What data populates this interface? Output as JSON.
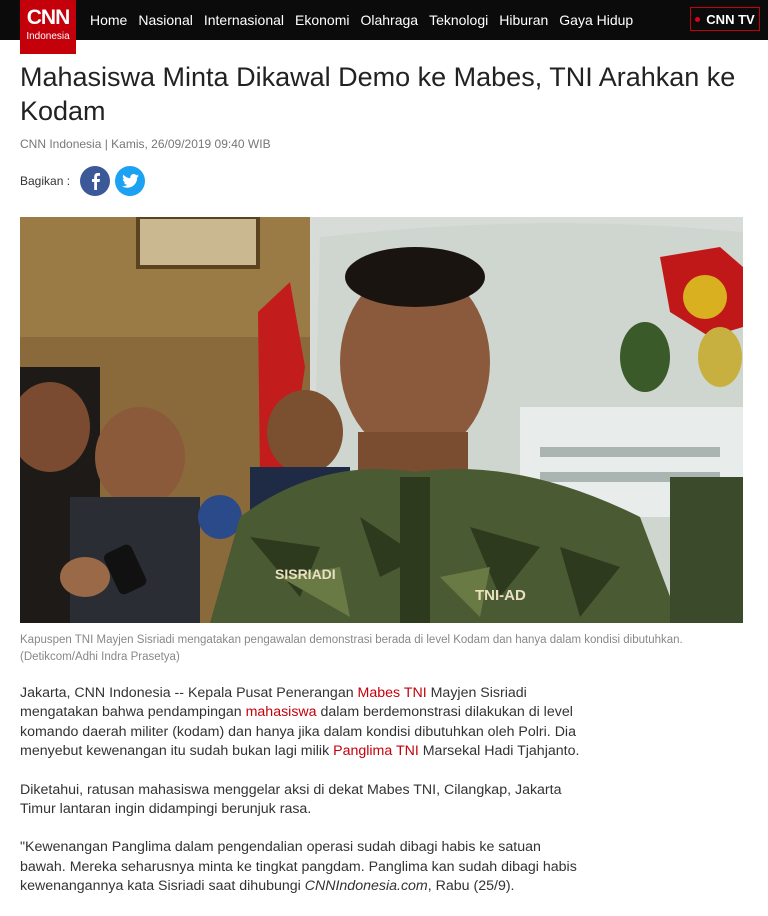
{
  "brand": {
    "logo": "CNN",
    "logo_sub": "Indonesia",
    "accent": "#c4000b"
  },
  "nav": {
    "items": [
      "Home",
      "Nasional",
      "Internasional",
      "Ekonomi",
      "Olahraga",
      "Teknologi",
      "Hiburan",
      "Gaya Hidup"
    ],
    "tv_label": "CNN TV"
  },
  "article": {
    "title": "Mahasiswa Minta Dikawal Demo ke Mabes, TNI Arahkan ke Kodam",
    "meta": "CNN Indonesia | Kamis, 26/09/2019 09:40 WIB",
    "share_label": "Bagikan :",
    "share_icons": [
      "facebook-icon",
      "twitter-icon"
    ],
    "photo_text": {
      "badge": "SISRIADI",
      "chest": "TNI-AD"
    },
    "caption": "Kapuspen TNI Mayjen Sisriadi mengatakan pengawalan demonstrasi berada di level Kodam dan hanya dalam kondisi dibutuhkan. (Detikcom/Adhi Indra Prasetya)",
    "p1": {
      "a": "Jakarta, CNN Indonesia -- Kepala Pusat Penerangan ",
      "link1": "Mabes TNI",
      "b": " Mayjen Sisriadi mengatakan bahwa pendampingan ",
      "link2": "mahasiswa",
      "c": " dalam berdemonstrasi dilakukan di level komando daerah militer (kodam) dan hanya jika dalam kondisi dibutuhkan oleh Polri. Dia menyebut kewenangan itu sudah bukan lagi milik ",
      "link3": "Panglima TNI",
      "d": " Marsekal Hadi Tjahjanto."
    },
    "p2": "Diketahui, ratusan mahasiswa menggelar aksi di dekat Mabes TNI, Cilangkap, Jakarta Timur lantaran ingin didampingi berunjuk rasa.",
    "p3": {
      "a": "\"Kewenangan Panglima dalam pengendalian operasi sudah dibagi habis ke satuan bawah. Mereka seharusnya minta ke tingkat pangdam. Panglima kan sudah dibagi habis kewenangannya kata Sisriadi saat dihubungi ",
      "em": "CNNIndonesia.com",
      "b": ", Rabu (25/9)."
    }
  }
}
